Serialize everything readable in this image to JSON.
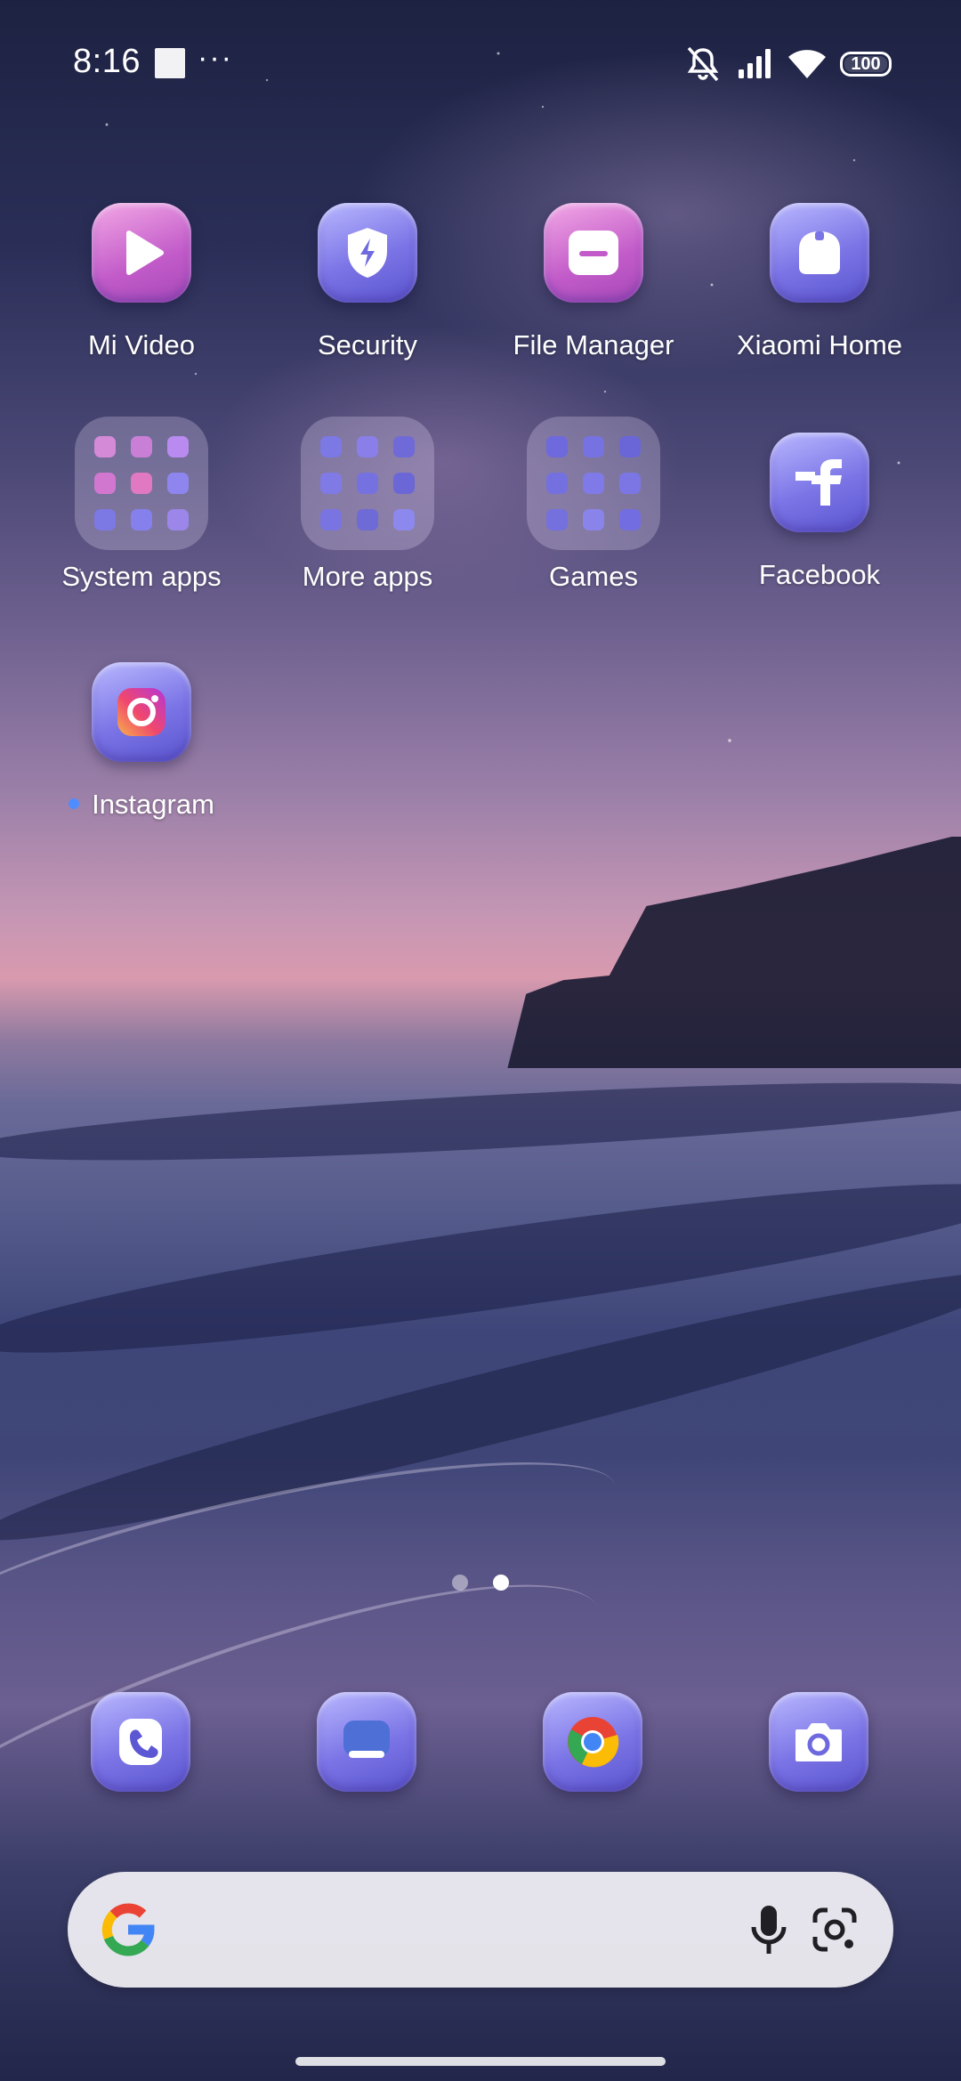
{
  "status_bar": {
    "time": "8:16",
    "more": "···",
    "battery": "100",
    "icons": [
      "notifications-off-icon",
      "signal-icon",
      "wifi-icon",
      "battery-icon"
    ]
  },
  "home_screen": {
    "apps": [
      {
        "label": "Mi Video",
        "icon": "play-icon"
      },
      {
        "label": "Security",
        "icon": "shield-bolt-icon"
      },
      {
        "label": "File Manager",
        "icon": "folder-icon"
      },
      {
        "label": "Xiaomi Home",
        "icon": "home-device-icon"
      },
      {
        "label": "System apps",
        "icon": "folder-icon"
      },
      {
        "label": "More apps",
        "icon": "folder-icon"
      },
      {
        "label": "Games",
        "icon": "folder-icon"
      },
      {
        "label": "Facebook",
        "icon": "facebook-icon"
      },
      {
        "label": "Instagram",
        "icon": "instagram-icon",
        "new_indicator": true
      }
    ]
  },
  "page_indicator": {
    "pages": 2,
    "current_page": 2
  },
  "dock": [
    {
      "name": "phone",
      "icon": "phone-icon"
    },
    {
      "name": "messages",
      "icon": "message-icon"
    },
    {
      "name": "chrome",
      "icon": "chrome-icon"
    },
    {
      "name": "camera",
      "icon": "camera-icon"
    }
  ],
  "search": {
    "icons": [
      "google-logo-icon",
      "mic-icon",
      "lens-icon"
    ]
  },
  "colors": {
    "icon_blue": "#7b74e6",
    "icon_pink": "#c25bc9",
    "new_dot": "#4f8dff",
    "search_bg": "#ecebf0"
  }
}
